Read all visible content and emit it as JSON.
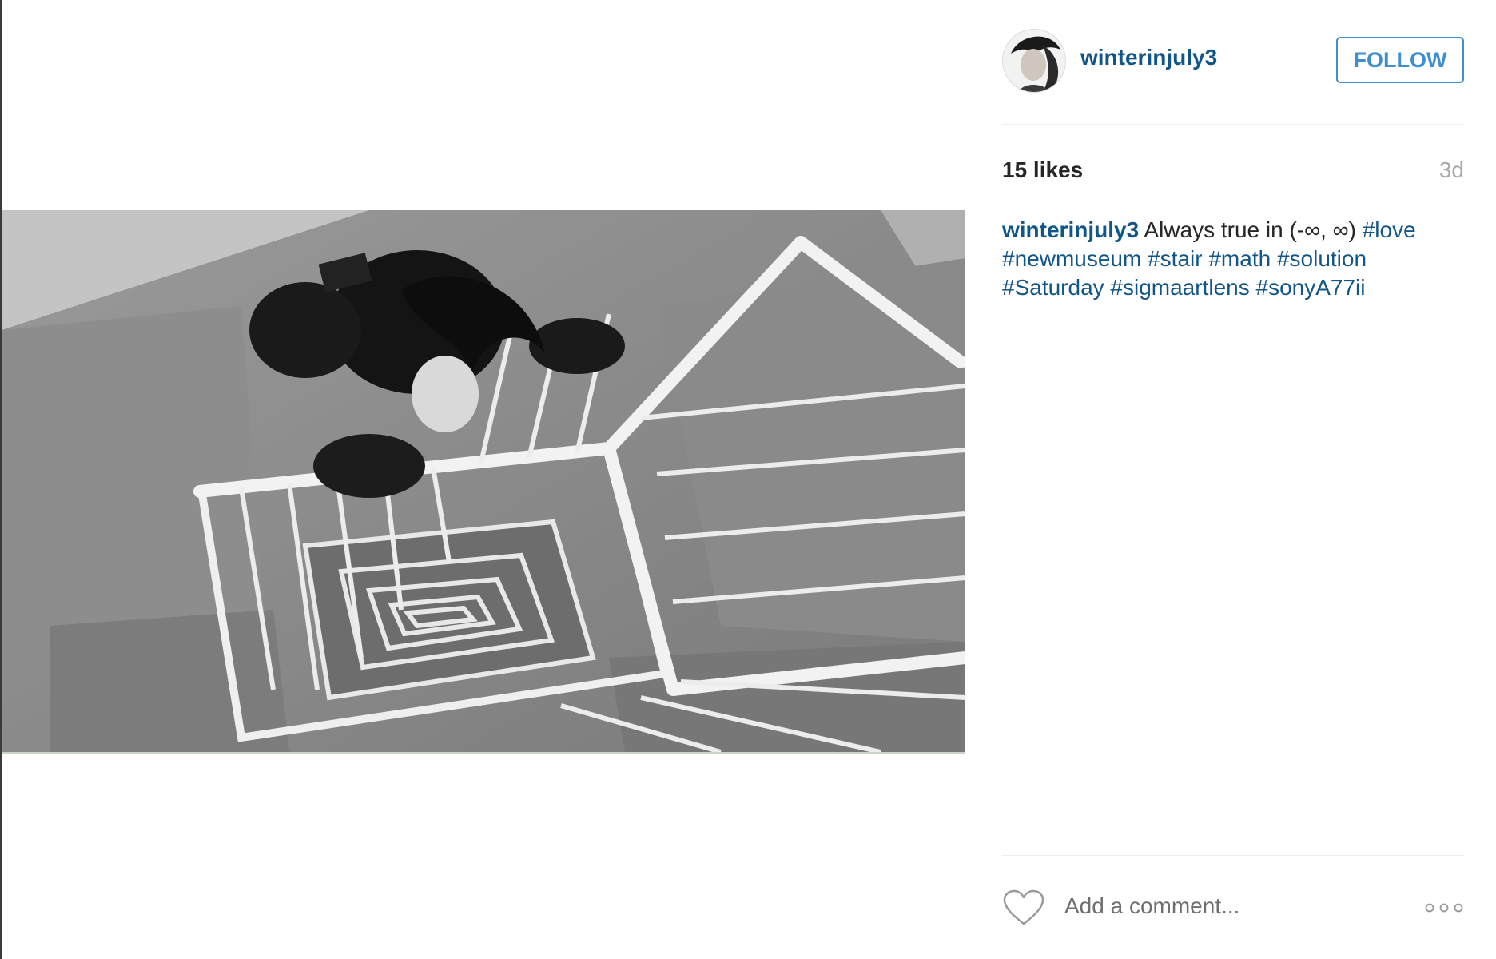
{
  "post": {
    "username": "winterinjuly3",
    "follow_label": "FOLLOW",
    "likes": "15 likes",
    "time_ago": "3d",
    "caption_username": "winterinjuly3",
    "caption_text": "Always true in (-∞, ∞)",
    "hashtags": [
      "#love",
      "#newmuseum",
      "#stair",
      "#math",
      "#solution",
      "#Saturday",
      "#sigmaartlens",
      "#sonyA77ii"
    ],
    "comment_placeholder": "Add a comment...",
    "icons": {
      "like": "heart-icon",
      "more": "more-options-icon"
    },
    "colors": {
      "link": "#125688",
      "follow": "#3f8fd0",
      "muted": "#a5a7aa"
    }
  }
}
